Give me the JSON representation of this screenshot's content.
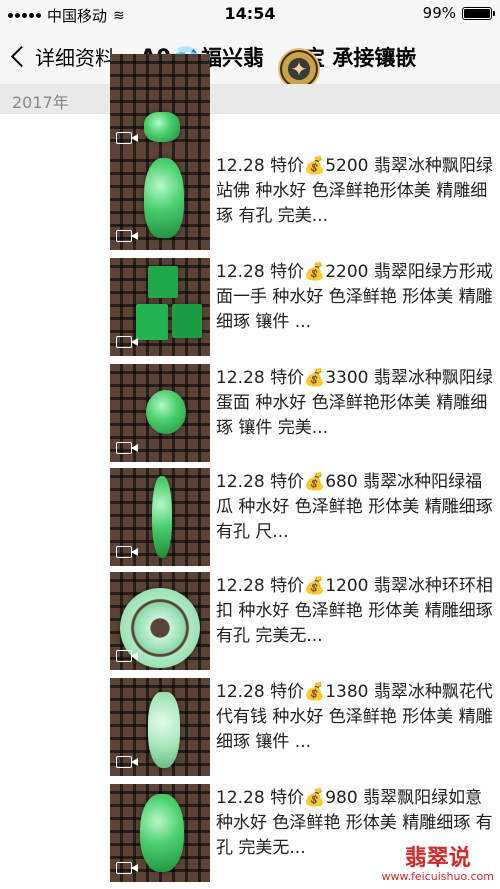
{
  "status": {
    "carrier": "中国移动",
    "time": "14:54",
    "battery": "99%",
    "battery_level": 0.99
  },
  "nav": {
    "back_label": "详细资料",
    "title_prefix": "A0",
    "title_main": "福兴翡",
    "title_suffix": "宝 承接镶嵌"
  },
  "year": "2017年",
  "items": [
    {
      "text": ""
    },
    {
      "text": "12.28 特价💰5200 翡翠冰种飘阳绿站佛 种水好 色泽鲜艳形体美 精雕细琢 有孔 完美..."
    },
    {
      "text": "12.28 特价💰2200 翡翠阳绿方形戒面一手 种水好 色泽鲜艳 形体美 精雕细琢 镶件 ..."
    },
    {
      "text": "12.28 特价💰3300 翡翠冰种飘阳绿蛋面 种水好 色泽鲜艳形体美 精雕细琢 镶件 完美..."
    },
    {
      "text": "12.28 特价💰680 翡翠冰种阳绿福瓜 种水好 色泽鲜艳 形体美 精雕细琢 有孔 尺..."
    },
    {
      "text": "12.28 特价💰1200 翡翠冰种环环相扣 种水好 色泽鲜艳 形体美 精雕细琢 有孔 完美无..."
    },
    {
      "text": "12.28 特价💰1380 翡翠冰种飘花代代有钱 种水好 色泽鲜艳 形体美 精雕细琢 镶件 ..."
    },
    {
      "text": "12.28 特价💰980 翡翠飘阳绿如意 种水好 色泽鲜艳 形体美 精雕细琢 有孔 完美无..."
    }
  ],
  "watermark": {
    "title": "翡翠说",
    "url": "www.feicuishuo.com"
  }
}
